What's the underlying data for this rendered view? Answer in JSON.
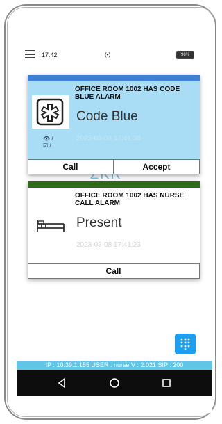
{
  "status_bar": {
    "time": "17:42",
    "signal_text": "(•)",
    "battery_text": "96%"
  },
  "watermark_text": "ZKR",
  "alarms": [
    {
      "title": "OFFICE ROOM 1002 HAS CODE BLUE ALARM",
      "status": "Code Blue",
      "timestamp": "2023-03-08 17:41:30",
      "icon": "medical-cross-icon",
      "strip_color": "#3f7fd4",
      "body_color": "#a9dcf5",
      "actions": [
        "Call",
        "Accept"
      ],
      "viewed_marker": "👁 /",
      "checked_marker": "☑ /"
    },
    {
      "title": "OFFICE ROOM 1002 HAS NURSE CALL ALARM",
      "status": "Present",
      "timestamp": "2023-03-08 17:41:23",
      "icon": "bed-icon",
      "strip_color": "#2e6b16",
      "body_color": "#ffffff",
      "actions": [
        "Call"
      ]
    }
  ],
  "info_bar": "IP : 10.39.1.155 USER : nurse V : 2.021 SIP : 200",
  "colors": {
    "accent_blue": "#1c9ff0",
    "info_bar": "#5fc6e7",
    "nav_bar": "#0d0d0d"
  }
}
